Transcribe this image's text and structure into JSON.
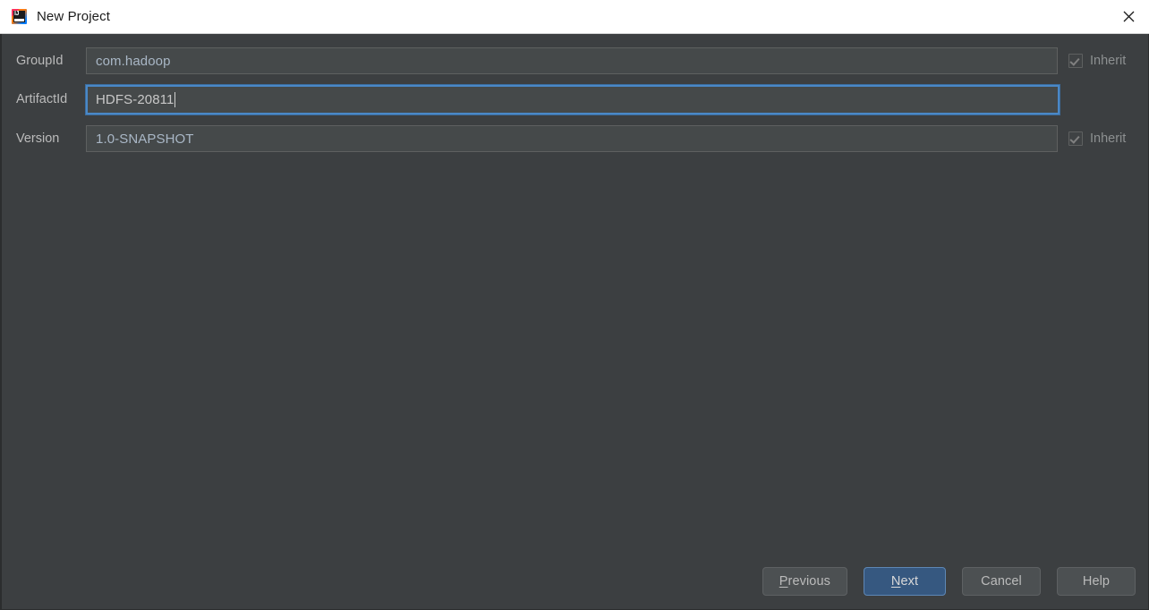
{
  "window": {
    "title": "New Project",
    "app_icon": "intellij-idea-icon",
    "icon_text": "IJ",
    "close_icon": "close-icon",
    "titlebar_bg": "#ffffff",
    "body_bg": "#3c3f41"
  },
  "form": {
    "fields": [
      {
        "label": "GroupId",
        "value": "com.hadoop",
        "focused": false,
        "inherit": {
          "label": "Inherit",
          "checked": true,
          "disabled": true
        }
      },
      {
        "label": "ArtifactId",
        "value": "HDFS-20811",
        "focused": true,
        "inherit": null
      },
      {
        "label": "Version",
        "value": "1.0-SNAPSHOT",
        "focused": false,
        "inherit": {
          "label": "Inherit",
          "checked": true,
          "disabled": true
        }
      }
    ]
  },
  "footer": {
    "previous": {
      "label": "Previous",
      "mnemonic": "P",
      "rest": "revious"
    },
    "next": {
      "label": "Next",
      "mnemonic": "N",
      "rest": "ext",
      "default": true,
      "accent": "#365880"
    },
    "cancel": {
      "label": "Cancel"
    },
    "help": {
      "label": "Help"
    }
  }
}
